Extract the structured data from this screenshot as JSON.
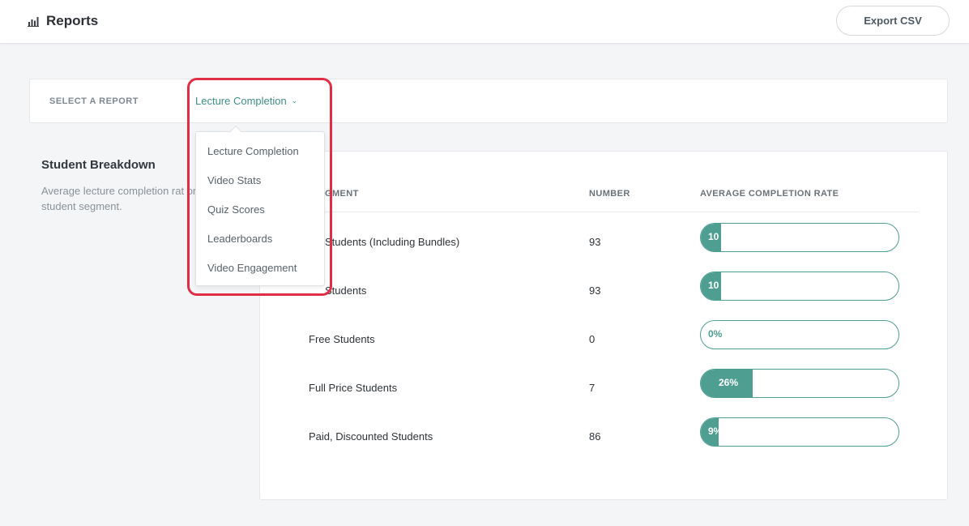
{
  "header": {
    "title": "Reports",
    "export_label": "Export CSV",
    "icon": "bar-chart-icon"
  },
  "selector": {
    "label": "SELECT A REPORT",
    "current": "Lecture Completion",
    "chevron": "⌄"
  },
  "dropdown": {
    "items": [
      "Lecture Completion",
      "Video Stats",
      "Quiz Scores",
      "Leaderboards",
      "Video Engagement"
    ]
  },
  "section": {
    "title": "Student Breakdown",
    "description": "Average lecture completion rat on student segment."
  },
  "table": {
    "headers": {
      "segment": "GMENT",
      "number": "NUMBER",
      "rate": "AVERAGE COMPLETION RATE"
    },
    "rows": [
      {
        "segment": "Students (Including Bundles)",
        "number": "93",
        "rate_label": "10",
        "rate": 0.1
      },
      {
        "segment": "Students",
        "number": "93",
        "rate_label": "10",
        "rate": 0.1
      },
      {
        "segment": "Free Students",
        "number": "0",
        "rate_label": "0%",
        "rate": 0.0
      },
      {
        "segment": "Full Price Students",
        "number": "7",
        "rate_label": "26%",
        "rate": 0.26
      },
      {
        "segment": "Paid, Discounted Students",
        "number": "86",
        "rate_label": "9%",
        "rate": 0.09
      }
    ]
  },
  "colors": {
    "accent": "#4e9e92",
    "highlight": "#e02f44"
  }
}
